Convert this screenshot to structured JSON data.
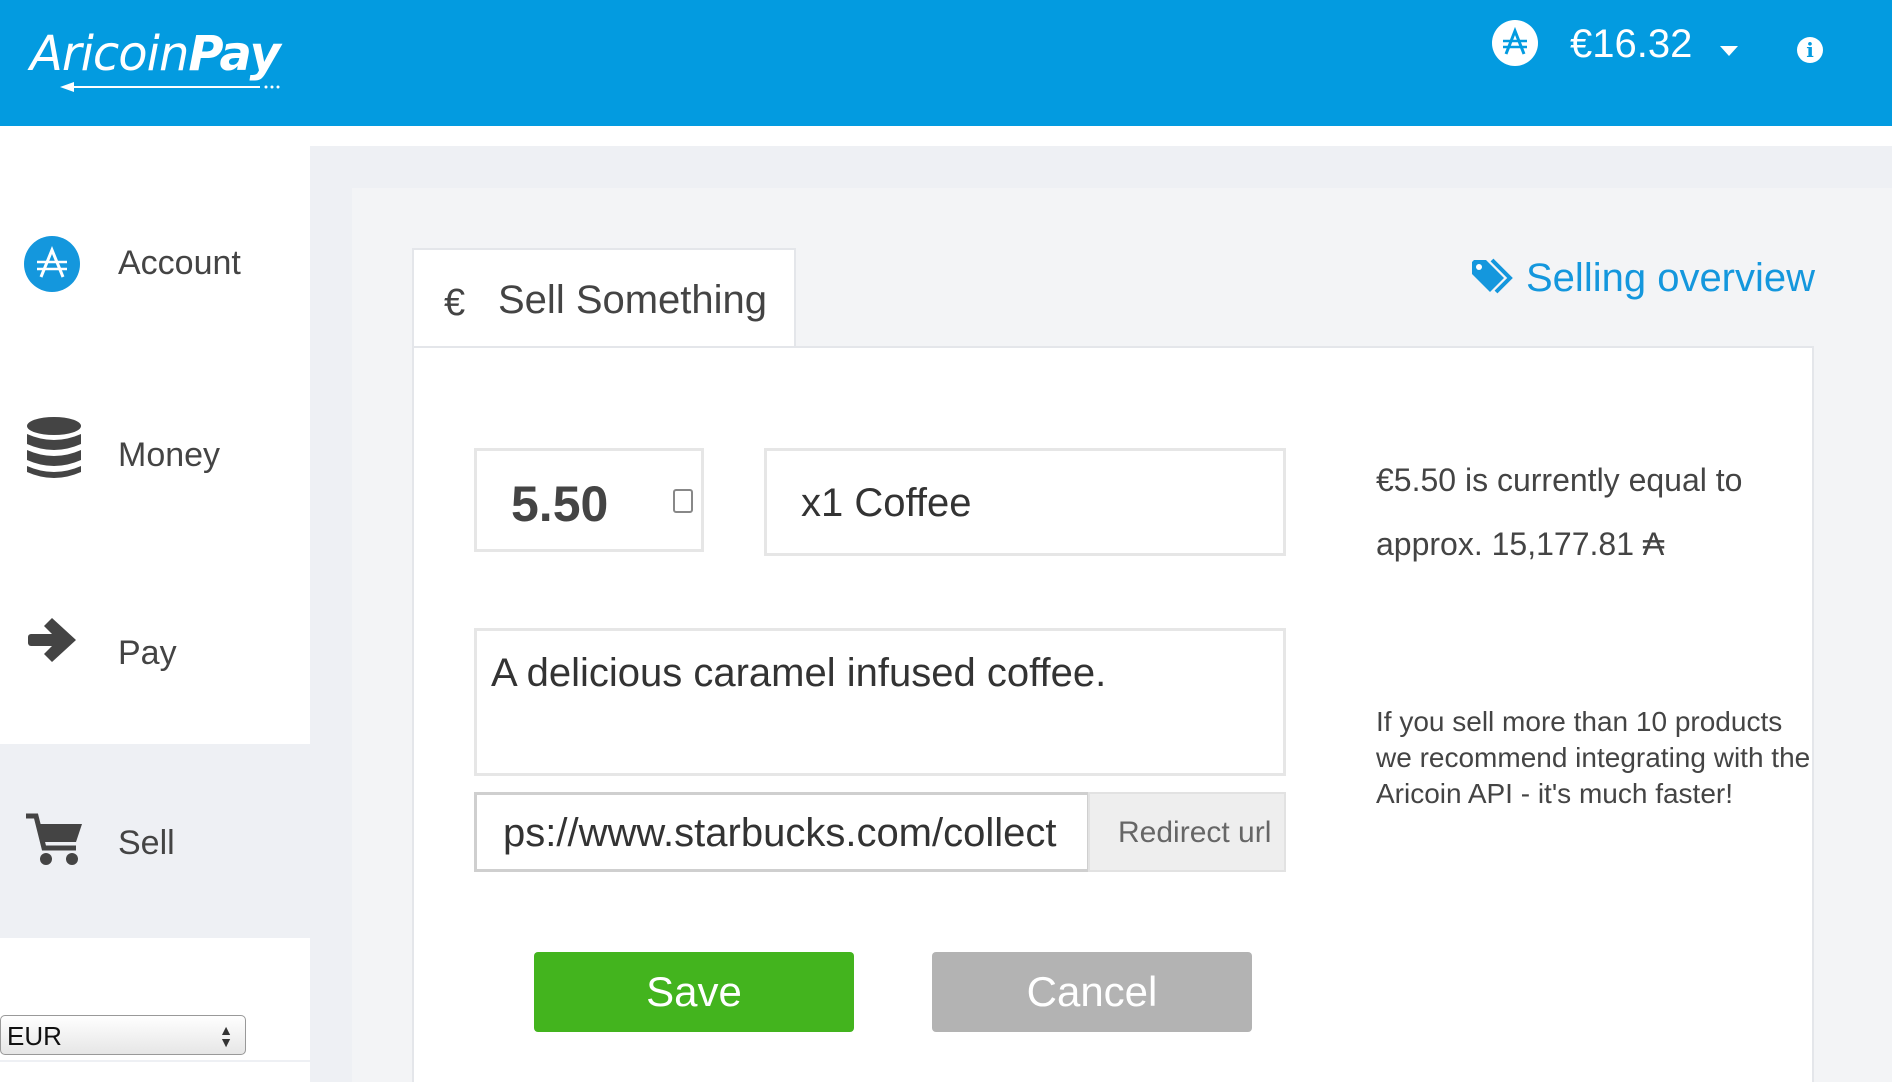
{
  "header": {
    "logo_light": "Aricoin",
    "logo_bold": "Pay",
    "balance": "€16.32",
    "coin_icon": "aricoin-icon",
    "info_icon": "info-icon"
  },
  "sidebar": {
    "items": [
      {
        "label": "Account",
        "icon": "aricoin-icon"
      },
      {
        "label": "Money",
        "icon": "coins-stack-icon"
      },
      {
        "label": "Pay",
        "icon": "arrow-right-icon"
      },
      {
        "label": "Sell",
        "icon": "shopping-cart-icon"
      }
    ],
    "currency_select": "EUR"
  },
  "main": {
    "tab": {
      "symbol": "€",
      "label": "Sell Something"
    },
    "selling_overview": "Selling overview",
    "form": {
      "price": "5.50",
      "name": "x1 Coffee",
      "description": "A delicious caramel infused coffee.",
      "redirect_url_value": "ps://www.starbucks.com/collect",
      "redirect_url_label": "Redirect url",
      "save_label": "Save",
      "cancel_label": "Cancel"
    },
    "conversion_line1": "€5.50 is currently equal to",
    "conversion_line2": "approx. 15,177.81 ₳",
    "hint": "If you sell more than 10 products we recommend integrating with the Aricoin API - it's much faster!"
  },
  "colors": {
    "brand_blue": "#039be0",
    "link_blue": "#1497dd",
    "save_green": "#43b41e",
    "cancel_gray": "#b3b3b3",
    "background_gray": "#eef0f4"
  }
}
